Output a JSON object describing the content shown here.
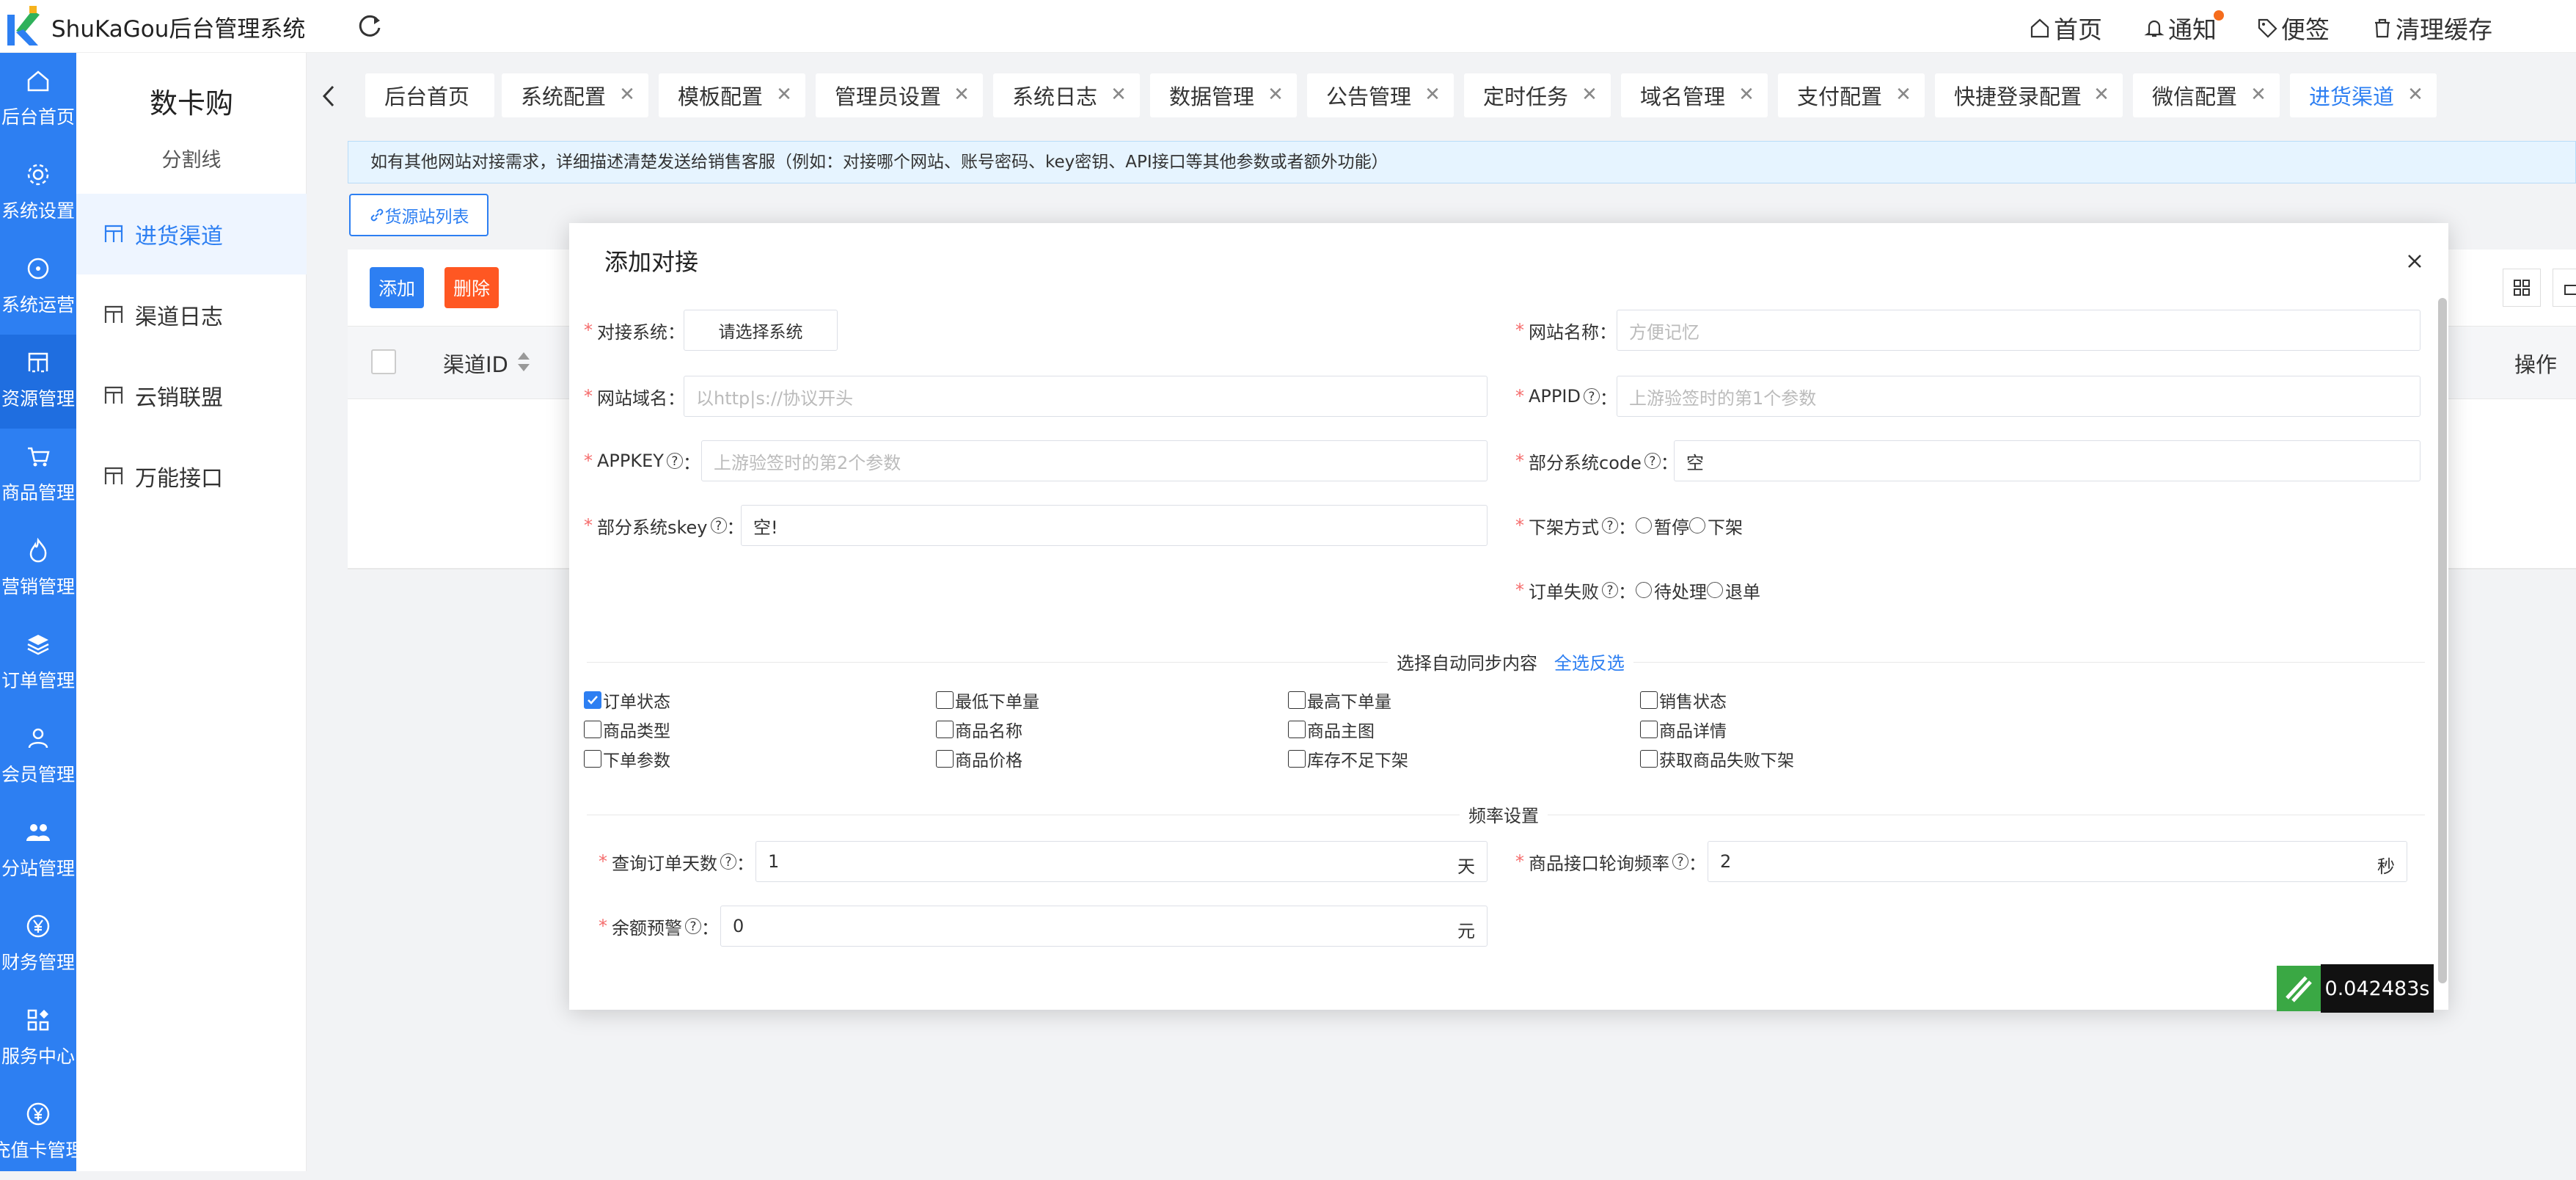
{
  "app": {
    "title": "ShuKaGou后台管理系统"
  },
  "topnav": {
    "home": "首页",
    "notify": "通知",
    "note": "便签",
    "clear_cache": "清理缓存"
  },
  "leftbar": [
    {
      "label": "后台首页",
      "icon": "home-icon"
    },
    {
      "label": "系统设置",
      "icon": "gear-icon"
    },
    {
      "label": "系统运营",
      "icon": "target-icon"
    },
    {
      "label": "资源管理",
      "icon": "grid-icon"
    },
    {
      "label": "商品管理",
      "icon": "cart-icon"
    },
    {
      "label": "营销管理",
      "icon": "fire-icon"
    },
    {
      "label": "订单管理",
      "icon": "layers-icon"
    },
    {
      "label": "会员管理",
      "icon": "user-icon"
    },
    {
      "label": "分站管理",
      "icon": "users-icon"
    },
    {
      "label": "财务管理",
      "icon": "yen-circle-icon"
    },
    {
      "label": "服务中心",
      "icon": "apps-icon"
    },
    {
      "label": "充值卡管理",
      "icon": "yen-circle-icon"
    }
  ],
  "subside": {
    "title": "数卡购",
    "divider": "分割线",
    "items": [
      {
        "label": "进货渠道"
      },
      {
        "label": "渠道日志"
      },
      {
        "label": "云销联盟"
      },
      {
        "label": "万能接口"
      }
    ]
  },
  "tabs": [
    "后台首页",
    "系统配置",
    "模板配置",
    "管理员设置",
    "系统日志",
    "数据管理",
    "公告管理",
    "定时任务",
    "域名管理",
    "支付配置",
    "快捷登录配置",
    "微信配置",
    "进货渠道"
  ],
  "notice": "如有其他网站对接需求，详细描述清楚发送给销售客服（例如：对接哪个网站、账号密码、key密钥、API接口等其他参数或者额外功能）",
  "toolbar": {
    "source_list": "货源站列表",
    "add": "添加",
    "delete": "删除"
  },
  "table": {
    "col_id": "渠道ID",
    "col_op": "操作"
  },
  "modal": {
    "title": "添加对接",
    "fields": {
      "system_label": "对接系统",
      "system_button": "请选择系统",
      "site_name_label": "网站名称",
      "site_name_placeholder": "方便记忆",
      "domain_label": "网站域名",
      "domain_placeholder": "以http|s://协议开头",
      "appid_label": "APPID",
      "appid_placeholder": "上游验签时的第1个参数",
      "appkey_label": "APPKEY",
      "appkey_placeholder": "上游验签时的第2个参数",
      "code_label": "部分系统code",
      "code_value": "空",
      "skey_label": "部分系统skey",
      "skey_value": "空!",
      "offshelf_label": "下架方式",
      "offshelf_opt1": "暂停",
      "offshelf_opt2": "下架",
      "fail_label": "订单失败",
      "fail_opt1": "待处理",
      "fail_opt2": "退单"
    },
    "sync": {
      "title": "选择自动同步内容",
      "toggle": "全选反选",
      "options": [
        {
          "label": "订单状态",
          "checked": true
        },
        {
          "label": "最低下单量",
          "checked": false
        },
        {
          "label": "最高下单量",
          "checked": false
        },
        {
          "label": "销售状态",
          "checked": false
        },
        {
          "label": "商品类型",
          "checked": false
        },
        {
          "label": "商品名称",
          "checked": false
        },
        {
          "label": "商品主图",
          "checked": false
        },
        {
          "label": "商品详情",
          "checked": false
        },
        {
          "label": "下单参数",
          "checked": false
        },
        {
          "label": "商品价格",
          "checked": false
        },
        {
          "label": "库存不足下架",
          "checked": false
        },
        {
          "label": "获取商品失败下架",
          "checked": false
        }
      ]
    },
    "freq": {
      "title": "频率设置",
      "query_days_label": "查询订单天数",
      "query_days_value": "1",
      "query_days_unit": "天",
      "poll_label": "商品接口轮询频率",
      "poll_value": "2",
      "poll_unit": "秒",
      "balance_label": "余额预警",
      "balance_value": "0",
      "balance_unit": "元"
    }
  },
  "timer": "0.042483s",
  "colors": {
    "primary": "#2d7ff2",
    "danger": "#ff5722",
    "required": "#f56c6c"
  }
}
